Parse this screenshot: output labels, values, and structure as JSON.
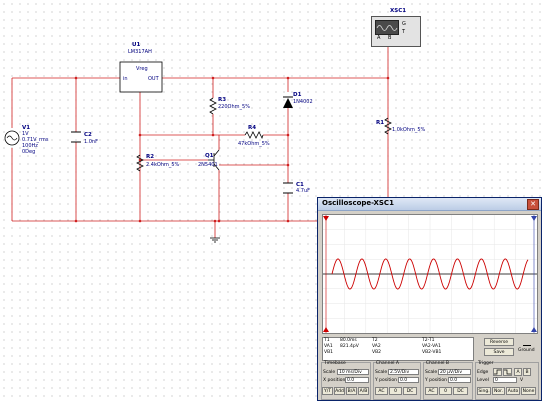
{
  "circuit": {
    "xsc_label": "XSC1",
    "xsc_terms": [
      "A",
      "B",
      "G",
      "T"
    ],
    "u1_ref": "U1",
    "u1_part": "LM317AH",
    "u1_pin_vreg": "Vreg",
    "u1_pin_in": "in",
    "u1_pin_out": "OUT",
    "v1_ref": "V1",
    "v1_lines": [
      "1V",
      "0.71V_rms",
      "100Hz",
      "0Deg"
    ],
    "c2_ref": "C2",
    "c2_val": "1.0nF",
    "r3_ref": "R3",
    "r3_val": "220Ohm_5%",
    "d1_ref": "D1",
    "d1_val": "1N4002",
    "r4_ref": "R4",
    "r4_val": "47kOhm_5%",
    "r1_ref": "R1",
    "r1_val": "1.0kOhm_5%",
    "r2_ref": "R2",
    "r2_val": "2.4kOhm_5%",
    "q1_ref": "Q1",
    "q1_val": "2N5401",
    "c1_ref": "C1",
    "c1_val": "4.7uF"
  },
  "oscilloscope": {
    "title": "Oscilloscope-XSC1",
    "close_glyph": "✕",
    "readout": {
      "t1": "T1",
      "t1_time": "80.0ms",
      "t1_va": "821.4pV",
      "t2": "T2",
      "t2_time": "",
      "t2_t1": "T2-T1",
      "va1": "VA1",
      "vb1": "VB1",
      "va2": "VA2",
      "vb2": "VB2",
      "va2_va1": "VA2-VA1",
      "vb2_vb1": "VB2-VB1"
    },
    "buttons": {
      "reverse": "Reverse",
      "save": "Save",
      "ground": "Ground"
    },
    "timebase": {
      "title": "Timebase",
      "scale_label": "Scale",
      "scale_value": "10 ms/Div",
      "xpos_label": "X position",
      "xpos_value": "0.0",
      "modes": [
        "Y/T",
        "Add",
        "B/A",
        "A/B"
      ]
    },
    "channel_a": {
      "title": "Channel A",
      "scale_label": "Scale",
      "scale_value": "2.5V/Div",
      "ypos_label": "Y position",
      "ypos_value": "0.0",
      "coupling": [
        "AC",
        "0",
        "DC"
      ]
    },
    "channel_b": {
      "title": "Channel B",
      "scale_label": "Scale",
      "scale_value": "20 µV/Div",
      "ypos_label": "Y position",
      "ypos_value": "0.0",
      "coupling": [
        "AC",
        "0",
        "DC"
      ]
    },
    "trigger": {
      "title": "Trigger",
      "edge_label": "Edge",
      "level_label": "Level",
      "level_value": "0",
      "level_unit": "V",
      "modes": [
        "Sing.",
        "Nor.",
        "Auto",
        "None"
      ]
    },
    "trace_color": "#cc0000",
    "cursor1_color": "#cc0000",
    "cursor2_color": "#3344aa"
  }
}
